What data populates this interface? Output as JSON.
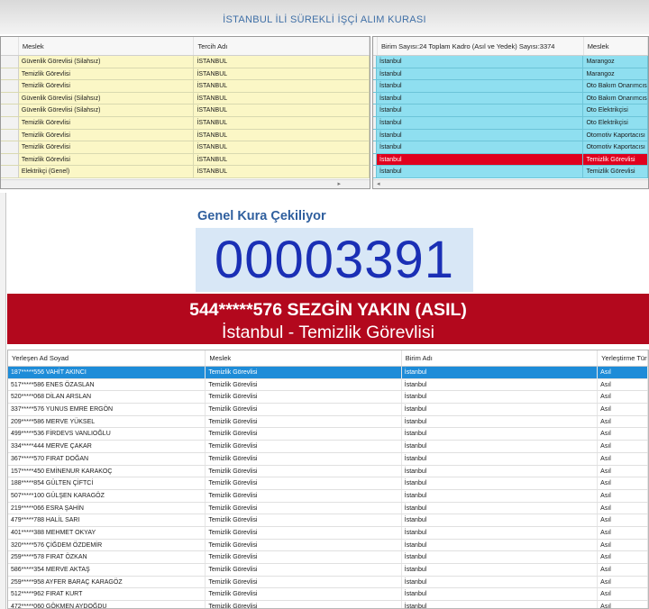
{
  "app": {
    "title": "İSTANBUL İLİ SÜREKLİ İŞÇİ ALIM KURASI"
  },
  "left_grid": {
    "columns": [
      "Meslek",
      "Tercih Adı"
    ],
    "rows": [
      [
        "Güvenlik Görevlisi (Silahsız)",
        "İSTANBUL"
      ],
      [
        "Temizlik Görevlisi",
        "İSTANBUL"
      ],
      [
        "Temizlik Görevlisi",
        "İSTANBUL"
      ],
      [
        "Güvenlik Görevlisi (Silahsız)",
        "İSTANBUL"
      ],
      [
        "Güvenlik Görevlisi (Silahsız)",
        "İSTANBUL"
      ],
      [
        "Temizlik Görevlisi",
        "İSTANBUL"
      ],
      [
        "Temizlik Görevlisi",
        "İSTANBUL"
      ],
      [
        "Temizlik Görevlisi",
        "İSTANBUL"
      ],
      [
        "Temizlik Görevlisi",
        "İSTANBUL"
      ],
      [
        "Elektrikçi (Genel)",
        "İSTANBUL"
      ]
    ]
  },
  "right_grid": {
    "columns": [
      "Birim Sayısı:24 Toplam Kadro (Asıl ve Yedek) Sayısı:3374",
      "Meslek"
    ],
    "rows": [
      [
        "İstanbul",
        "Marangoz"
      ],
      [
        "İstanbul",
        "Marangoz"
      ],
      [
        "İstanbul",
        "Oto Bakım Onarımcısı (Ot"
      ],
      [
        "İstanbul",
        "Oto Bakım Onarımcısı (Ot"
      ],
      [
        "İstanbul",
        "Oto Elektrikçisi"
      ],
      [
        "İstanbul",
        "Oto Elektrikçisi"
      ],
      [
        "İstanbul",
        "Otomotiv Kaportacısı"
      ],
      [
        "İstanbul",
        "Otomotiv Kaportacısı"
      ],
      [
        "İstanbul",
        "Temizlik Görevlisi"
      ],
      [
        "İstanbul",
        "Temizlik Görevlisi"
      ]
    ],
    "selected_row": 8
  },
  "draw": {
    "label": "Genel Kura Çekiliyor",
    "number": "00003391",
    "winner_line1": "544*****576 SEZGİN YAKIN (ASIL)",
    "winner_line2": "İstanbul - Temizlik Görevlisi"
  },
  "results_grid": {
    "columns": [
      "Yerleşen Ad Soyad",
      "Meslek",
      "Birim Adı",
      "Yerleştirme Türü"
    ],
    "rows": [
      [
        "187*****556 VAHİT AKINCI",
        "Temizlik Görevlisi",
        "İstanbul",
        "Asıl"
      ],
      [
        "517*****586 ENES ÖZASLAN",
        "Temizlik Görevlisi",
        "İstanbul",
        "Asıl"
      ],
      [
        "520*****068 DİLAN ARSLAN",
        "Temizlik Görevlisi",
        "İstanbul",
        "Asıl"
      ],
      [
        "337*****576 YUNUS EMRE ERGÖN",
        "Temizlik Görevlisi",
        "İstanbul",
        "Asıl"
      ],
      [
        "209*****586 MERVE YÜKSEL",
        "Temizlik Görevlisi",
        "İstanbul",
        "Asıl"
      ],
      [
        "499*****536 FİRDEVS VANLIOĞLU",
        "Temizlik Görevlisi",
        "İstanbul",
        "Asıl"
      ],
      [
        "334*****444 MERVE ÇAKAR",
        "Temizlik Görevlisi",
        "İstanbul",
        "Asıl"
      ],
      [
        "367*****570 FIRAT DOĞAN",
        "Temizlik Görevlisi",
        "İstanbul",
        "Asıl"
      ],
      [
        "157*****450 EMİNENUR KARAKOÇ",
        "Temizlik Görevlisi",
        "İstanbul",
        "Asıl"
      ],
      [
        "188*****854 GÜLTEN ÇİFTCİ",
        "Temizlik Görevlisi",
        "İstanbul",
        "Asıl"
      ],
      [
        "507*****100 GÜLŞEN KARAGÖZ",
        "Temizlik Görevlisi",
        "İstanbul",
        "Asıl"
      ],
      [
        "219*****066 ESRA ŞAHİN",
        "Temizlik Görevlisi",
        "İstanbul",
        "Asıl"
      ],
      [
        "479*****788 HALİL SARI",
        "Temizlik Görevlisi",
        "İstanbul",
        "Asıl"
      ],
      [
        "401*****388 MEHMET OKYAY",
        "Temizlik Görevlisi",
        "İstanbul",
        "Asıl"
      ],
      [
        "320*****576 ÇİĞDEM ÖZDEMİR",
        "Temizlik Görevlisi",
        "İstanbul",
        "Asıl"
      ],
      [
        "259*****578 FIRAT ÖZKAN",
        "Temizlik Görevlisi",
        "İstanbul",
        "Asıl"
      ],
      [
        "586*****354 MERVE AKTAŞ",
        "Temizlik Görevlisi",
        "İstanbul",
        "Asıl"
      ],
      [
        "259*****958 AYFER BARAÇ KARAGÖZ",
        "Temizlik Görevlisi",
        "İstanbul",
        "Asıl"
      ],
      [
        "512*****962 FIRAT KURT",
        "Temizlik Görevlisi",
        "İstanbul",
        "Asıl"
      ],
      [
        "472*****060 GÖKMEN AYDOĞDU",
        "Temizlik Görevlisi",
        "İstanbul",
        "Asıl"
      ]
    ],
    "selected_row": 0
  },
  "colors": {
    "left_grid_row": "#fbf7c6",
    "right_grid_row": "#8fdff0",
    "selected_red": "#e0001e",
    "banner": "#b3081d",
    "number_color": "#1a2fb5",
    "selected_blue": "#1e8cd8"
  },
  "icons": {
    "scroll_left": "◂",
    "scroll_right": "▸"
  }
}
